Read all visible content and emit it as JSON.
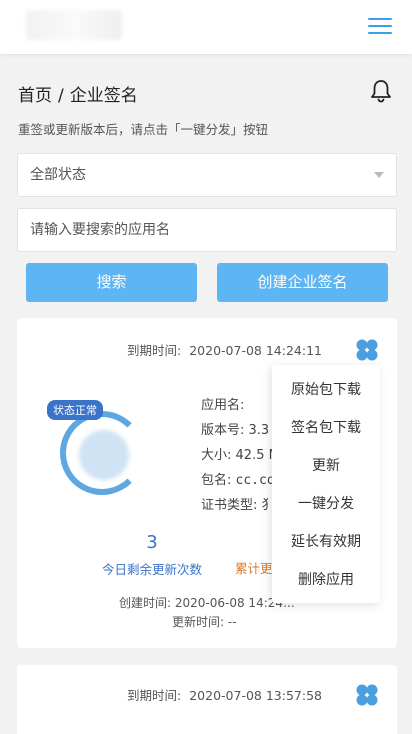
{
  "header": {
    "menu_icon": "hamburger-menu-icon"
  },
  "breadcrumb": {
    "home": "首页",
    "separator": "/",
    "current": "企业签名"
  },
  "notification_icon": "bell-icon",
  "tip": "重签或更新版本后，请点击「一键分发」按钮",
  "filter": {
    "status_selected": "全部状态"
  },
  "search": {
    "placeholder": "请输入要搜索的应用名",
    "button": "搜索"
  },
  "create_button": "创建企业签名",
  "cards": [
    {
      "expire_label": "到期时间:",
      "expire_time": "2020-07-08 14:24:11",
      "status_badge": "状态正常",
      "app_name_label": "应用名:",
      "version_label": "版本号:",
      "version_value": "3.3",
      "size_label": "大小:",
      "size_value": "42.5 M",
      "package_label": "包名:",
      "package_value": "cc.co",
      "cert_label": "证书类型:",
      "cert_value": "犭",
      "remaining_updates": "3",
      "remaining_updates_label": "今日剩余更新次数",
      "total_label": "累计更",
      "created_label": "创建时间:",
      "created_time": "2020-06-08 14:24:..",
      "updated_label": "更新时间:",
      "updated_time": "--"
    },
    {
      "expire_label": "到期时间:",
      "expire_time": "2020-07-08 13:57:58"
    }
  ],
  "dropdown": {
    "items": [
      "原始包下载",
      "签名包下载",
      "更新",
      "一键分发",
      "延长有效期",
      "删除应用"
    ]
  },
  "colors": {
    "accent": "#5db5f3",
    "link_blue": "#3a73c8",
    "orange": "#e07a2a"
  }
}
